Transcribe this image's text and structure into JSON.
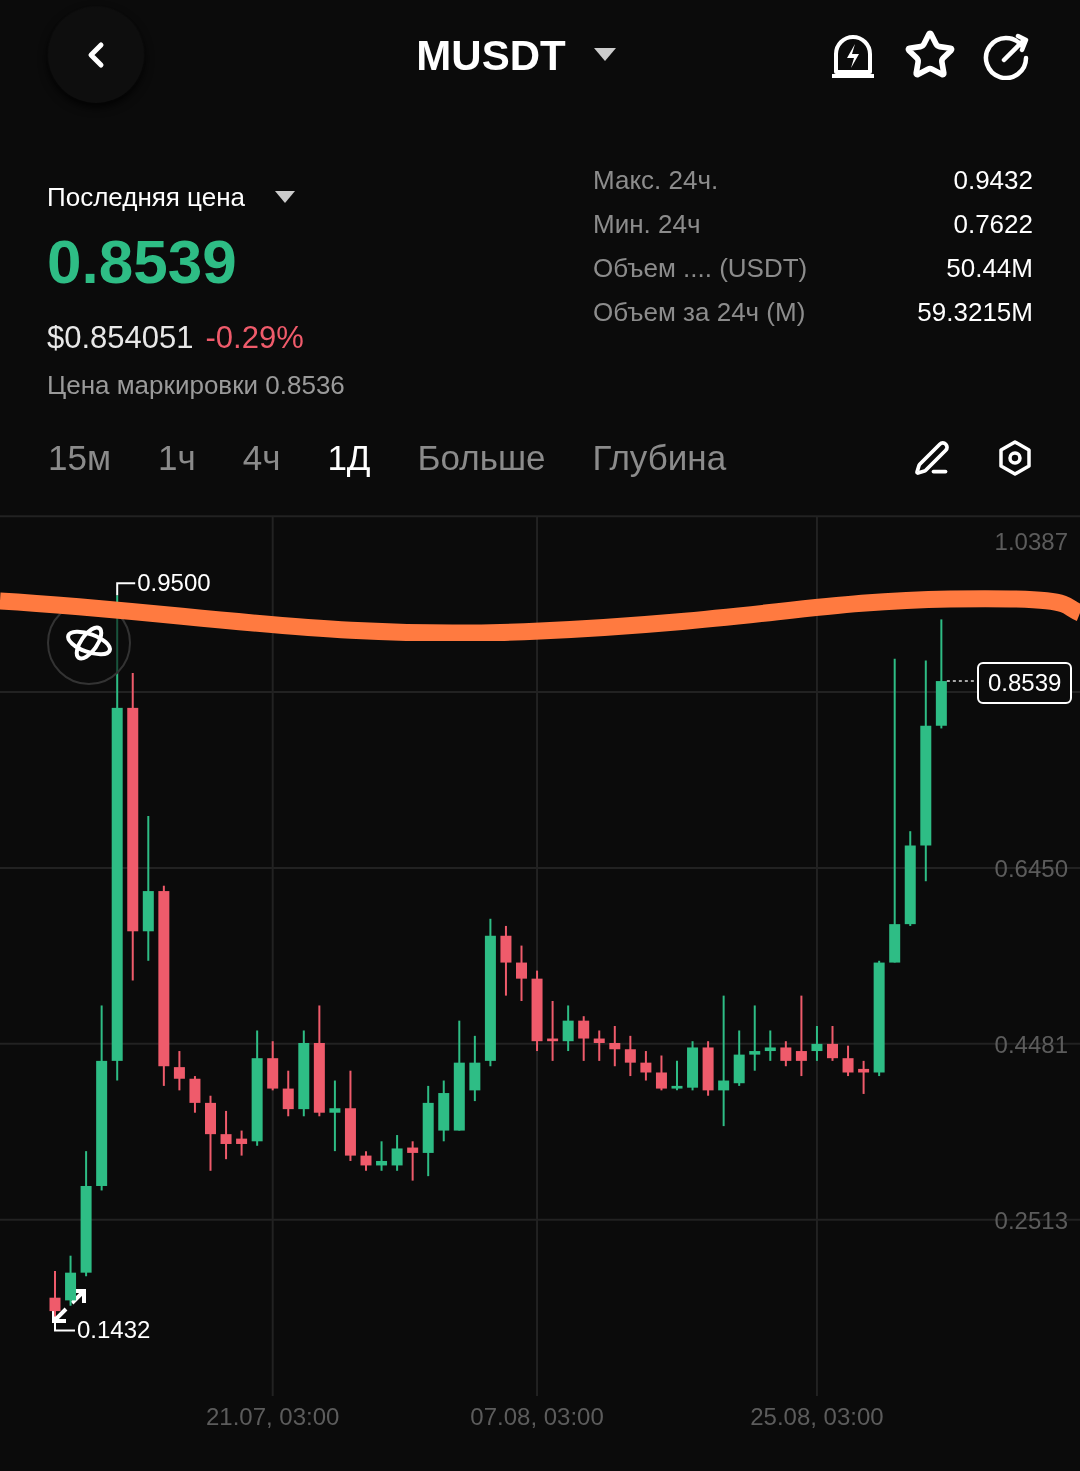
{
  "header": {
    "title": "MUSDT"
  },
  "price": {
    "label": "Последняя цена",
    "last": "0.8539",
    "usd": "$0.854051",
    "change": "-0.29%",
    "mark": "Цена маркировки 0.8536"
  },
  "stats": [
    {
      "label": "Макс. 24ч.",
      "value": "0.9432"
    },
    {
      "label": "Мин. 24ч",
      "value": "0.7622"
    },
    {
      "label": "Объем .... (USDT)",
      "value": "50.44M"
    },
    {
      "label": "Объем за 24ч (M)",
      "value": "59.3215M"
    }
  ],
  "timeframes": [
    {
      "label": "15м",
      "selected": false
    },
    {
      "label": "1ч",
      "selected": false
    },
    {
      "label": "4ч",
      "selected": false
    },
    {
      "label": "1Д",
      "selected": true
    },
    {
      "label": "Больше",
      "selected": false
    },
    {
      "label": "Глубина",
      "selected": false
    }
  ],
  "chart": {
    "max_label": "0.9500",
    "min_label": "0.1432",
    "price_tag": "0.8539",
    "chart_data": {
      "type": "candlestick",
      "grid": true,
      "ylim": [
        0.054,
        1.0387
      ],
      "yticks": [
        {
          "value": 1.0387,
          "label": "1.0387"
        },
        {
          "value": 0.645,
          "label": "0.6450"
        },
        {
          "value": 0.4481,
          "label": "0.4481"
        },
        {
          "value": 0.2513,
          "label": "0.2513"
        }
      ],
      "categories": [
        null,
        null,
        null,
        null,
        null,
        null,
        null,
        null,
        null,
        null,
        null,
        null,
        null,
        null,
        "21.07, 03:00",
        null,
        null,
        null,
        null,
        null,
        null,
        null,
        null,
        null,
        null,
        null,
        null,
        null,
        null,
        null,
        null,
        "07.08, 03:00",
        null,
        null,
        null,
        null,
        null,
        null,
        null,
        null,
        null,
        null,
        null,
        null,
        null,
        null,
        null,
        null,
        null,
        "25.08, 03:00",
        null,
        null,
        null,
        null,
        null,
        null,
        null,
        null
      ],
      "ohlc": [
        [
          0.164,
          0.194,
          0.143,
          0.149
        ],
        [
          0.161,
          0.211,
          0.155,
          0.192
        ],
        [
          0.192,
          0.328,
          0.188,
          0.289
        ],
        [
          0.289,
          0.491,
          0.284,
          0.429
        ],
        [
          0.429,
          0.95,
          0.407,
          0.824
        ],
        [
          0.824,
          0.863,
          0.519,
          0.574
        ],
        [
          0.574,
          0.703,
          0.541,
          0.619
        ],
        [
          0.619,
          0.625,
          0.401,
          0.423
        ],
        [
          0.422,
          0.44,
          0.396,
          0.409
        ],
        [
          0.409,
          0.412,
          0.371,
          0.382
        ],
        [
          0.382,
          0.39,
          0.306,
          0.347
        ],
        [
          0.347,
          0.373,
          0.319,
          0.336
        ],
        [
          0.342,
          0.351,
          0.323,
          0.336
        ],
        [
          0.339,
          0.463,
          0.334,
          0.432
        ],
        [
          0.432,
          0.451,
          0.396,
          0.398
        ],
        [
          0.398,
          0.418,
          0.367,
          0.375
        ],
        [
          0.375,
          0.463,
          0.367,
          0.449
        ],
        [
          0.449,
          0.491,
          0.367,
          0.371
        ],
        [
          0.371,
          0.407,
          0.328,
          0.376
        ],
        [
          0.376,
          0.418,
          0.317,
          0.323
        ],
        [
          0.323,
          0.328,
          0.306,
          0.312
        ],
        [
          0.312,
          0.339,
          0.306,
          0.317
        ],
        [
          0.312,
          0.346,
          0.306,
          0.331
        ],
        [
          0.332,
          0.339,
          0.295,
          0.326
        ],
        [
          0.326,
          0.401,
          0.3,
          0.382
        ],
        [
          0.351,
          0.407,
          0.339,
          0.393
        ],
        [
          0.351,
          0.474,
          0.351,
          0.427
        ],
        [
          0.396,
          0.457,
          0.384,
          0.427
        ],
        [
          0.429,
          0.588,
          0.423,
          0.569
        ],
        [
          0.569,
          0.58,
          0.502,
          0.539
        ],
        [
          0.539,
          0.558,
          0.496,
          0.521
        ],
        [
          0.521,
          0.53,
          0.44,
          0.451
        ],
        [
          0.454,
          0.496,
          0.429,
          0.451
        ],
        [
          0.451,
          0.491,
          0.44,
          0.474
        ],
        [
          0.474,
          0.479,
          0.429,
          0.454
        ],
        [
          0.454,
          0.463,
          0.429,
          0.449
        ],
        [
          0.449,
          0.468,
          0.423,
          0.442
        ],
        [
          0.442,
          0.457,
          0.412,
          0.427
        ],
        [
          0.427,
          0.44,
          0.407,
          0.416
        ],
        [
          0.416,
          0.435,
          0.396,
          0.398
        ],
        [
          0.398,
          0.429,
          0.396,
          0.401
        ],
        [
          0.399,
          0.451,
          0.396,
          0.444
        ],
        [
          0.444,
          0.451,
          0.39,
          0.396
        ],
        [
          0.396,
          0.502,
          0.356,
          0.407
        ],
        [
          0.404,
          0.463,
          0.401,
          0.436
        ],
        [
          0.436,
          0.491,
          0.418,
          0.44
        ],
        [
          0.44,
          0.463,
          0.429,
          0.444
        ],
        [
          0.444,
          0.451,
          0.423,
          0.429
        ],
        [
          0.44,
          0.502,
          0.412,
          0.429
        ],
        [
          0.44,
          0.468,
          0.429,
          0.448
        ],
        [
          0.448,
          0.468,
          0.429,
          0.432
        ],
        [
          0.432,
          0.446,
          0.412,
          0.416
        ],
        [
          0.42,
          0.429,
          0.392,
          0.416
        ],
        [
          0.416,
          0.541,
          0.412,
          0.539
        ],
        [
          0.539,
          0.879,
          0.539,
          0.582
        ],
        [
          0.582,
          0.686,
          0.58,
          0.67
        ],
        [
          0.67,
          0.877,
          0.63,
          0.804
        ],
        [
          0.804,
          0.923,
          0.801,
          0.854
        ]
      ]
    }
  }
}
